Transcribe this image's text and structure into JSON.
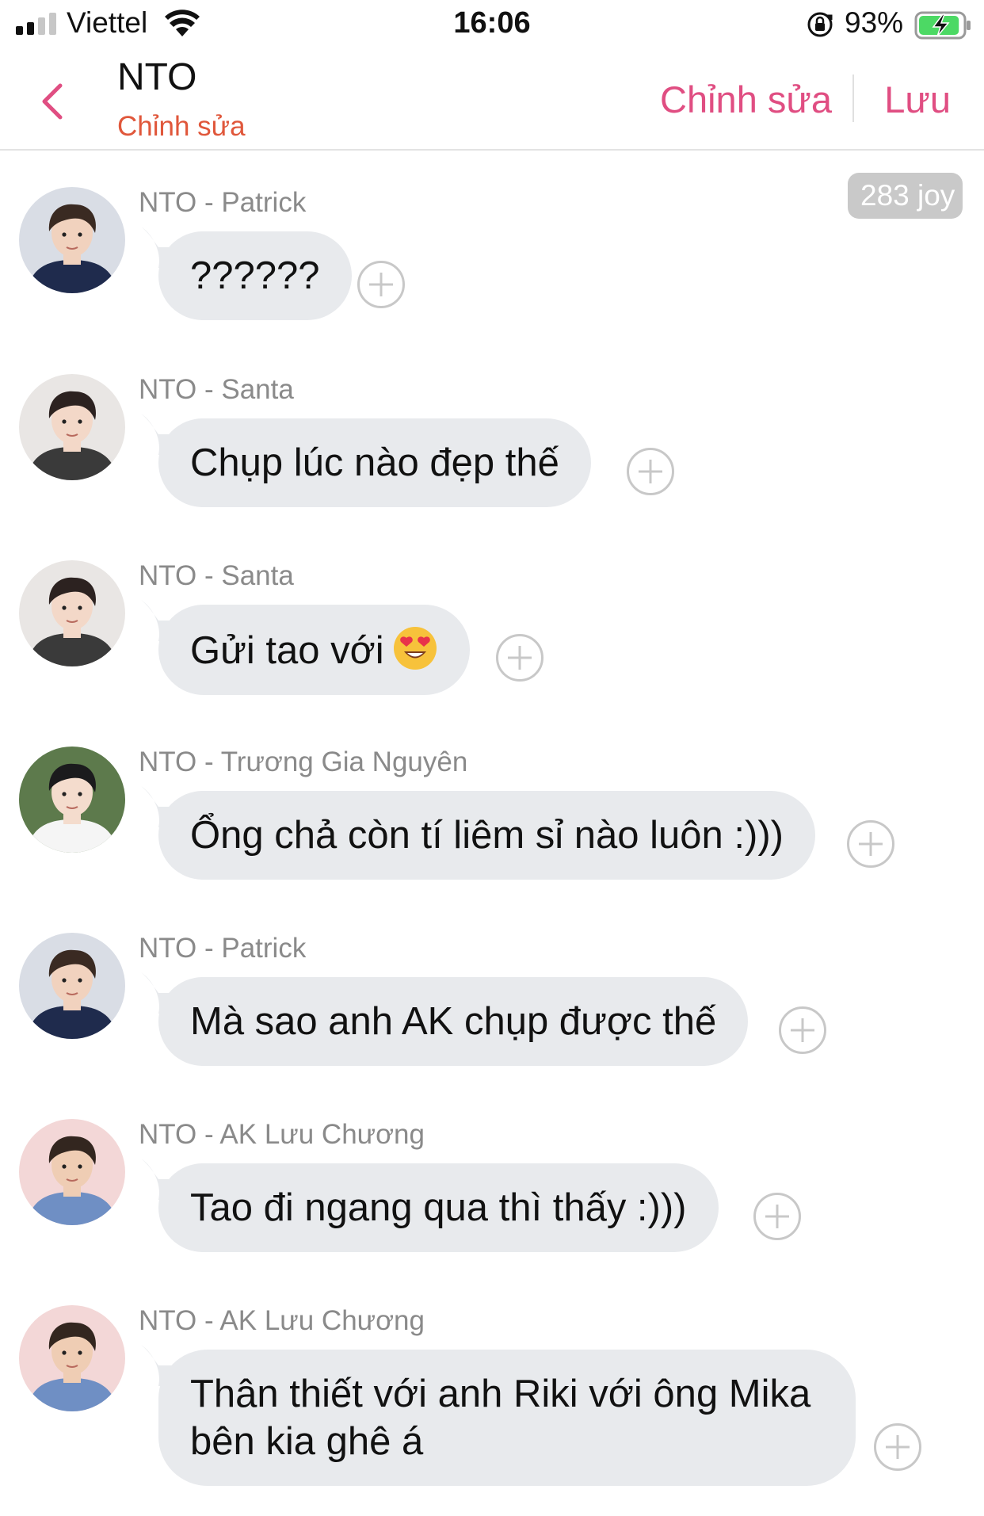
{
  "status_bar": {
    "carrier": "Viettel",
    "time": "16:06",
    "battery_percent": "93%",
    "battery_level": 0.93,
    "icons": [
      "signal-icon",
      "wifi-icon",
      "rotation-lock-icon",
      "battery-charging-icon"
    ]
  },
  "header": {
    "title": "NTO",
    "subtitle": "Chỉnh sửa",
    "edit_label": "Chỉnh sửa",
    "save_label": "Lưu",
    "back_icon": "chevron-left-icon"
  },
  "joy_badge": "283 joy",
  "colors": {
    "accent": "#e04e82",
    "subtitle": "#e0573b",
    "bubble": "#e8eaed",
    "sender": "#8a8a8a"
  },
  "messages": [
    {
      "sender": "NTO - Patrick",
      "text": "??????"
    },
    {
      "sender": "NTO - Santa",
      "text": "Chụp lúc nào đẹp thế"
    },
    {
      "sender": "NTO - Santa",
      "text": "Gửi tao với",
      "emoji": "heart-eyes-emoji"
    },
    {
      "sender": "NTO - Trương Gia Nguyên",
      "text": "Ổng chả còn tí liêm sỉ nào luôn :)))"
    },
    {
      "sender": "NTO - Patrick",
      "text": "Mà sao anh AK chụp được thế"
    },
    {
      "sender": "NTO - AK Lưu Chương",
      "text": "Tao đi ngang qua thì thấy :)))"
    },
    {
      "sender": "NTO - AK Lưu Chương",
      "text": "Thân thiết với anh Riki với ông Mika bên kia ghê á"
    }
  ]
}
